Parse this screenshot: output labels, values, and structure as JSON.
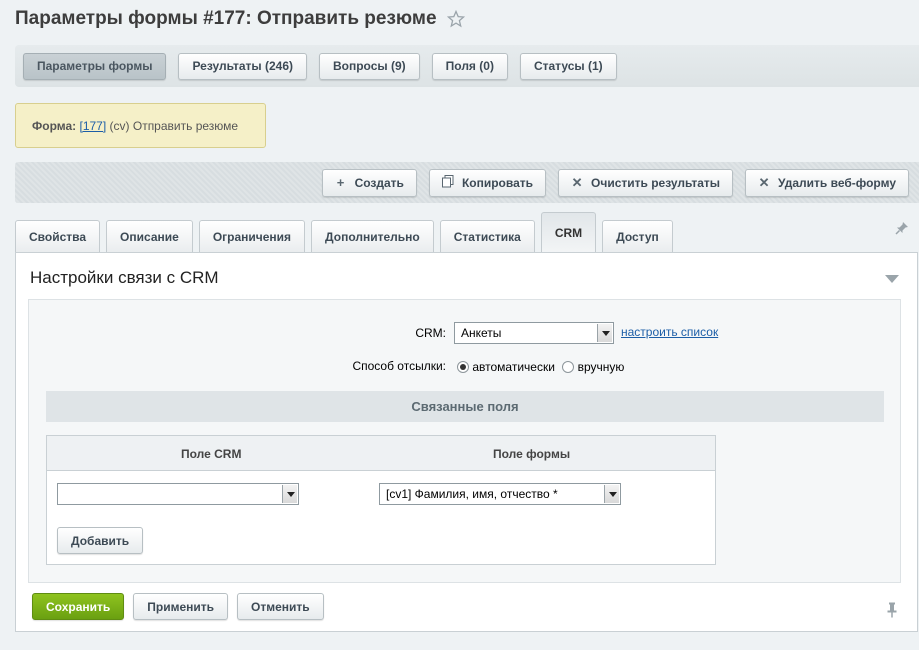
{
  "title": "Параметры формы #177: Отправить резюме",
  "top_tabs": [
    {
      "label": "Параметры формы",
      "pressed": true
    },
    {
      "label": "Результаты (246)"
    },
    {
      "label": "Вопросы (9)"
    },
    {
      "label": "Поля (0)"
    },
    {
      "label": "Статусы (1)"
    }
  ],
  "form_note": {
    "label": "Форма:",
    "id_link": "[177]",
    "rest": "(cv) Отправить резюме"
  },
  "toolbar": {
    "create": "Создать",
    "copy": "Копировать",
    "clear": "Очистить результаты",
    "delete": "Удалить веб-форму"
  },
  "tabs": [
    {
      "label": "Свойства"
    },
    {
      "label": "Описание"
    },
    {
      "label": "Ограничения"
    },
    {
      "label": "Дополнительно"
    },
    {
      "label": "Статистика"
    },
    {
      "label": "CRM",
      "active": true
    },
    {
      "label": "Доступ"
    }
  ],
  "panel": {
    "title": "Настройки связи с CRM",
    "crm_label": "CRM:",
    "crm_value": "Анкеты",
    "configure_link": "настроить список",
    "send_label": "Способ отсылки:",
    "send_auto": "автоматически",
    "send_manual": "вручную",
    "section_title": "Связанные поля",
    "col_crm": "Поле CRM",
    "col_form": "Поле формы",
    "crm_field_value": "",
    "form_field_value": "[cv1] Фамилия, имя, отчество *",
    "add_button": "Добавить"
  },
  "footer": {
    "save": "Сохранить",
    "apply": "Применить",
    "cancel": "Отменить"
  },
  "colors": {
    "accent_green": "#7ab317",
    "link": "#1c5ea7"
  }
}
